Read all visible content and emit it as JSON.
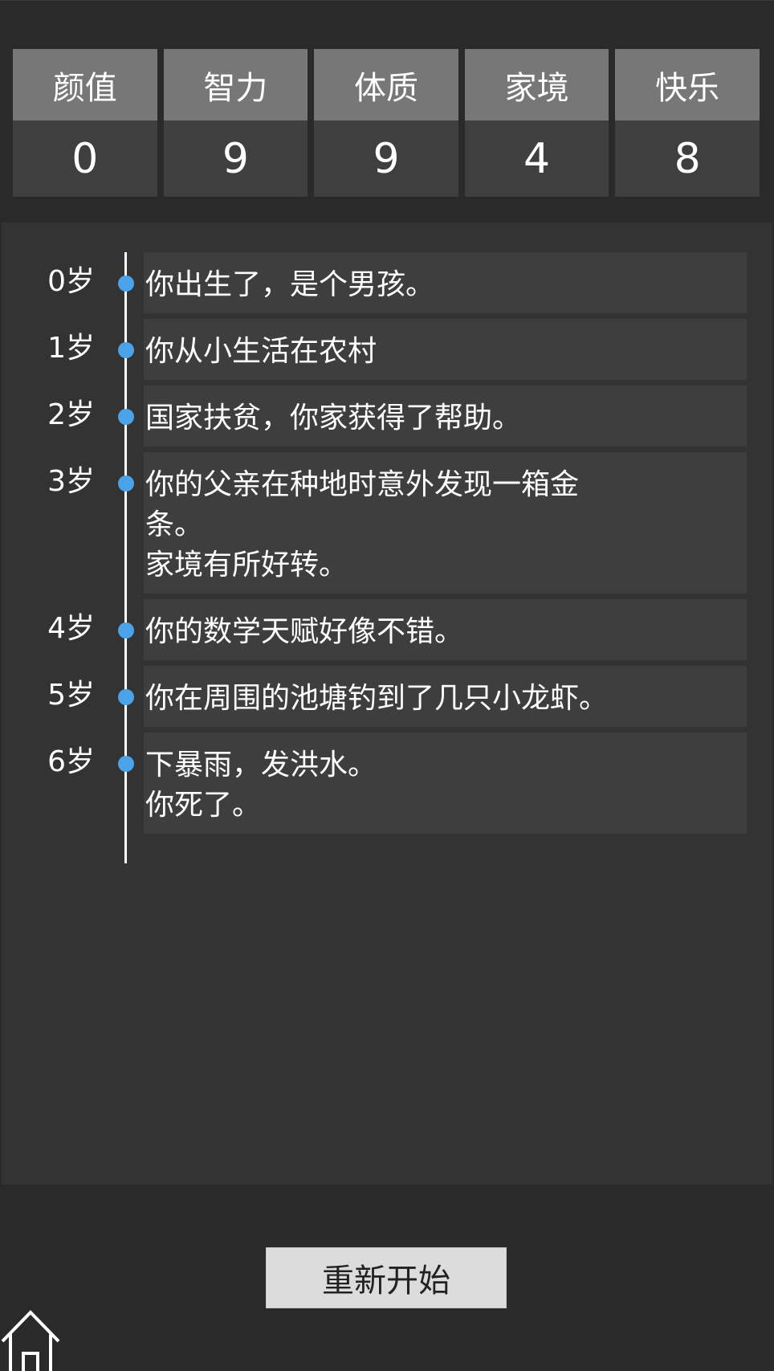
{
  "stats": [
    {
      "label": "颜值",
      "value": "0"
    },
    {
      "label": "智力",
      "value": "9"
    },
    {
      "label": "体质",
      "value": "9"
    },
    {
      "label": "家境",
      "value": "4"
    },
    {
      "label": "快乐",
      "value": "8"
    }
  ],
  "events": [
    {
      "age": "0岁",
      "text": "你出生了，是个男孩。"
    },
    {
      "age": "1岁",
      "text": "你从小生活在农村"
    },
    {
      "age": "2岁",
      "text": "国家扶贫，你家获得了帮助。"
    },
    {
      "age": "3岁",
      "text": "你的父亲在种地时意外发现一箱金\n条。\n家境有所好转。"
    },
    {
      "age": "4岁",
      "text": "你的数学天赋好像不错。"
    },
    {
      "age": "5岁",
      "text": "你在周围的池塘钓到了几只小龙虾。"
    },
    {
      "age": "6岁",
      "text": "下暴雨，发洪水。\n你死了。"
    }
  ],
  "restart_label": "重新开始",
  "home_icon": "home-icon",
  "colors": {
    "background": "#2a2a2a",
    "panel": "#333333",
    "stat_label_bg": "#777777",
    "stat_value_bg": "#3f3f3f",
    "bubble_bg": "#3e3e3e",
    "timeline_dot": "#4aa3e8",
    "button_bg": "#dcdcdc"
  }
}
